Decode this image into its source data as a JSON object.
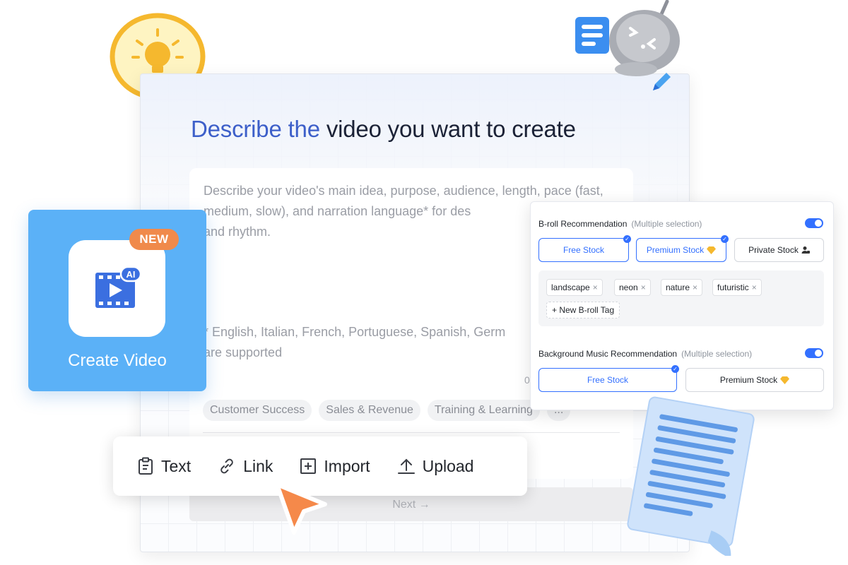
{
  "editor": {
    "headline_accent": "Describe the",
    "headline_rest": "video you want to create",
    "prompt_placeholder": "Describe your video's main idea, purpose, audience, length, pace (fast, medium, slow), and narration language* for des",
    "prompt_line3": "and rhythm.",
    "language_note_line1": "* English, Italian, French, Portuguese, Spanish, Germ",
    "language_note_line2": "are supported",
    "char_count": "0",
    "chips": [
      "Customer Success",
      "Sales & Revenue",
      "Training & Learning",
      "..."
    ],
    "next_label": "Next →"
  },
  "toolbar": {
    "text_label": "Text",
    "link_label": "Link",
    "import_label": "Import",
    "upload_label": "Upload"
  },
  "create_video": {
    "badge": "NEW",
    "ai_badge": "AI",
    "label": "Create Video"
  },
  "recommendations": {
    "broll_title": "B-roll Recommendation",
    "broll_hint": "(Multiple selection)",
    "broll_enabled": true,
    "broll_options": [
      "Free Stock",
      "Premium Stock",
      "Private Stock"
    ],
    "broll_selected": [
      "Free Stock",
      "Premium Stock"
    ],
    "tags": [
      "landscape",
      "neon",
      "nature",
      "futuristic"
    ],
    "new_tag_label": "+ New B-roll Tag",
    "music_title": "Background Music Recommendation",
    "music_hint": "(Multiple selection)",
    "music_enabled": true,
    "music_options": [
      "Free Stock",
      "Premium Stock"
    ],
    "music_selected": [
      "Free Stock"
    ]
  },
  "colors": {
    "accent_blue": "#3370ff",
    "headline_blue": "#3d5fc9",
    "tile_blue": "#5bb1f7",
    "badge_orange": "#f08a4b",
    "cursor_orange": "#f5894a",
    "bulb_yellow": "#f5b82e"
  },
  "icons": [
    "lightbulb-icon",
    "robot-icon",
    "document-icon",
    "clipboard-icon",
    "link-icon",
    "import-icon",
    "upload-icon",
    "cursor-icon",
    "video-ai-icon",
    "diamond-icon",
    "private-user-icon",
    "paper-scroll-icon"
  ]
}
